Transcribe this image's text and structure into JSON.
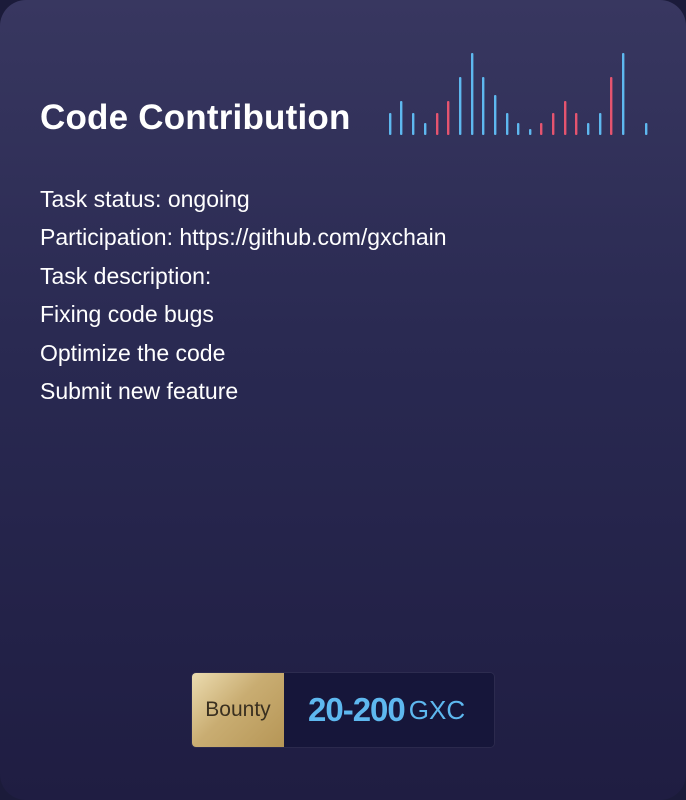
{
  "card": {
    "title": "Code Contribution",
    "details": [
      "Task status: ongoing",
      "Participation: https://github.com/gxchain",
      "Task description:",
      "Fixing code bugs",
      "Optimize the code",
      "Submit new feature"
    ]
  },
  "bounty": {
    "label": "Bounty",
    "amount": "20-200",
    "unit": "GXC"
  },
  "colors": {
    "accent_blue": "#5eb8ef",
    "accent_red": "#e5546f",
    "gold": "#c9ad72"
  },
  "icons": {
    "decoration": "equalizer-bars-icon"
  }
}
